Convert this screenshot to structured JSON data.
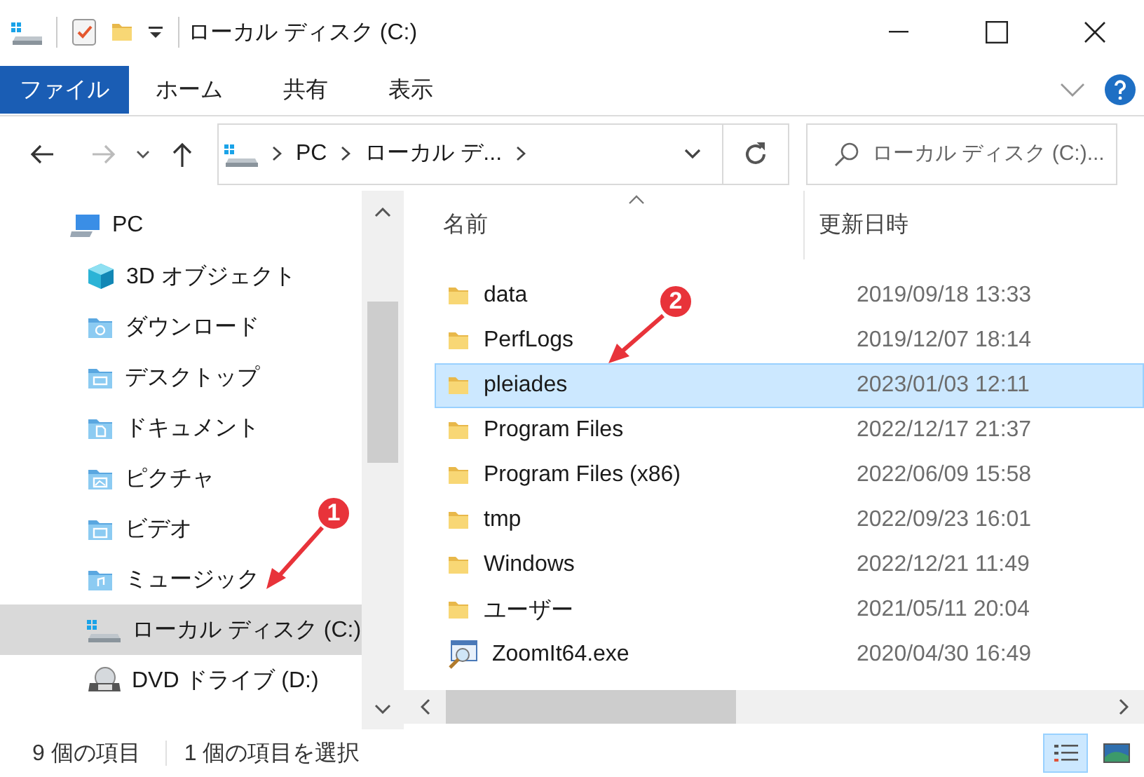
{
  "window": {
    "title": "ローカル ディスク (C:)"
  },
  "ribbon": {
    "tabs": [
      {
        "label": "ファイル",
        "kind": "file"
      },
      {
        "label": "ホーム",
        "kind": "tab"
      },
      {
        "label": "共有",
        "kind": "tab"
      },
      {
        "label": "表示",
        "kind": "tab"
      }
    ]
  },
  "address_bar": {
    "segments": [
      "PC",
      "ローカル デ..."
    ],
    "search_placeholder": "ローカル ディスク (C:)..."
  },
  "navigation": {
    "items": [
      {
        "label": "PC",
        "kind": "pc",
        "selected": false,
        "children": [
          {
            "label": "3D オブジェクト",
            "kind": "objects3d",
            "selected": false
          },
          {
            "label": "ダウンロード",
            "kind": "downloads",
            "selected": false
          },
          {
            "label": "デスクトップ",
            "kind": "desktop",
            "selected": false
          },
          {
            "label": "ドキュメント",
            "kind": "documents",
            "selected": false
          },
          {
            "label": "ピクチャ",
            "kind": "pictures",
            "selected": false
          },
          {
            "label": "ビデオ",
            "kind": "videos",
            "selected": false
          },
          {
            "label": "ミュージック",
            "kind": "music",
            "selected": false
          },
          {
            "label": "ローカル ディスク (C:)",
            "kind": "drive",
            "selected": true
          },
          {
            "label": "DVD ドライブ (D:)",
            "kind": "dvd",
            "selected": false
          }
        ]
      }
    ]
  },
  "file_list": {
    "columns": [
      "名前",
      "更新日時"
    ],
    "rows": [
      {
        "name": "data",
        "modified": "2019/09/18 13:33",
        "kind": "folder",
        "selected": false
      },
      {
        "name": "PerfLogs",
        "modified": "2019/12/07 18:14",
        "kind": "folder",
        "selected": false
      },
      {
        "name": "pleiades",
        "modified": "2023/01/03 12:11",
        "kind": "folder",
        "selected": true
      },
      {
        "name": "Program Files",
        "modified": "2022/12/17 21:37",
        "kind": "folder",
        "selected": false
      },
      {
        "name": "Program Files (x86)",
        "modified": "2022/06/09 15:58",
        "kind": "folder",
        "selected": false
      },
      {
        "name": "tmp",
        "modified": "2022/09/23 16:01",
        "kind": "folder",
        "selected": false
      },
      {
        "name": "Windows",
        "modified": "2022/12/21 11:49",
        "kind": "folder",
        "selected": false
      },
      {
        "name": "ユーザー",
        "modified": "2021/05/11 20:04",
        "kind": "folder",
        "selected": false
      },
      {
        "name": "ZoomIt64.exe",
        "modified": "2020/04/30 16:49",
        "kind": "exe",
        "selected": false
      }
    ]
  },
  "status_bar": {
    "item_count": "9 個の項目",
    "selection": "1 個の項目を選択",
    "views": [
      {
        "kind": "details",
        "selected": true
      },
      {
        "kind": "large-icons",
        "selected": false
      }
    ]
  },
  "annotations": [
    {
      "label": "1",
      "kind": "navigation"
    },
    {
      "label": "2",
      "kind": "file_list"
    }
  ]
}
